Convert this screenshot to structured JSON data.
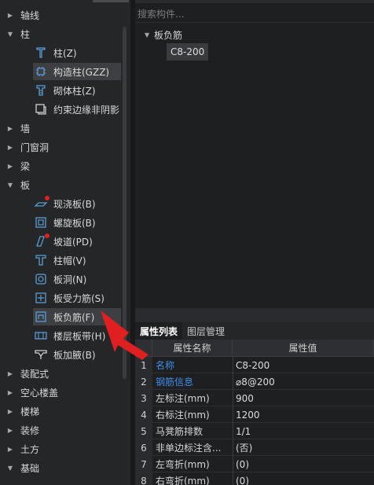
{
  "search": {
    "placeholder": "搜索构件..."
  },
  "tree": {
    "categories_top": [
      {
        "label": "轴线",
        "expanded": false
      },
      {
        "label": "柱",
        "expanded": true
      }
    ],
    "column_items": [
      {
        "label": "柱(Z)",
        "icon": "column-icon"
      },
      {
        "label": "构造柱(GZZ)",
        "icon": "construction-column-icon",
        "selected": true
      },
      {
        "label": "砌体柱(Z)",
        "icon": "masonry-column-icon"
      },
      {
        "label": "约束边缘非阴影",
        "icon": "edge-constraint-icon"
      }
    ],
    "categories_mid": [
      {
        "label": "墙",
        "expanded": false
      },
      {
        "label": "门窗洞",
        "expanded": false
      },
      {
        "label": "梁",
        "expanded": false
      },
      {
        "label": "板",
        "expanded": true
      }
    ],
    "slab_items": [
      {
        "label": "现浇板(B)",
        "icon": "cast-slab-icon",
        "dot": true
      },
      {
        "label": "螺旋板(B)",
        "icon": "spiral-slab-icon"
      },
      {
        "label": "坡道(PD)",
        "icon": "ramp-icon",
        "dot": true
      },
      {
        "label": "柱帽(V)",
        "icon": "column-cap-icon"
      },
      {
        "label": "板洞(N)",
        "icon": "slab-hole-icon"
      },
      {
        "label": "板受力筋(S)",
        "icon": "slab-rebar-icon"
      },
      {
        "label": "板负筋(F)",
        "icon": "slab-negative-rebar-icon",
        "selected": true
      },
      {
        "label": "楼层板带(H)",
        "icon": "floor-strip-icon"
      },
      {
        "label": "板加腋(B)",
        "icon": "slab-haunch-icon"
      }
    ],
    "categories_bottom": [
      {
        "label": "装配式",
        "expanded": false
      },
      {
        "label": "空心楼盖",
        "expanded": false
      },
      {
        "label": "楼梯",
        "expanded": false
      },
      {
        "label": "装修",
        "expanded": false
      },
      {
        "label": "土方",
        "expanded": false
      },
      {
        "label": "基础",
        "expanded": true
      }
    ]
  },
  "components": {
    "parent": "板负筋",
    "child": "C8-200"
  },
  "tabs": [
    {
      "label": "属性列表",
      "active": true
    },
    {
      "label": "图层管理",
      "active": false
    }
  ],
  "grid": {
    "headers": {
      "name": "属性名称",
      "value": "属性值"
    },
    "rows": [
      {
        "idx": "1",
        "name": "名称",
        "value": "C8-200",
        "link": true
      },
      {
        "idx": "2",
        "name": "钢筋信息",
        "value": "⌀8@200",
        "link": true
      },
      {
        "idx": "3",
        "name": "左标注(mm)",
        "value": "900",
        "link": false
      },
      {
        "idx": "4",
        "name": "右标注(mm)",
        "value": "1200",
        "link": false
      },
      {
        "idx": "5",
        "name": "马凳筋排数",
        "value": "1/1",
        "link": false
      },
      {
        "idx": "6",
        "name": "非单边标注含...",
        "value": "(否)",
        "link": false
      },
      {
        "idx": "7",
        "name": "左弯折(mm)",
        "value": "(0)",
        "link": false
      },
      {
        "idx": "8",
        "name": "右弯折(mm)",
        "value": "(0)",
        "link": false
      }
    ]
  },
  "colors": {
    "link": "#3f8ee8",
    "annotation_arrow": "#e02020",
    "icon": "#5b9bd5"
  }
}
